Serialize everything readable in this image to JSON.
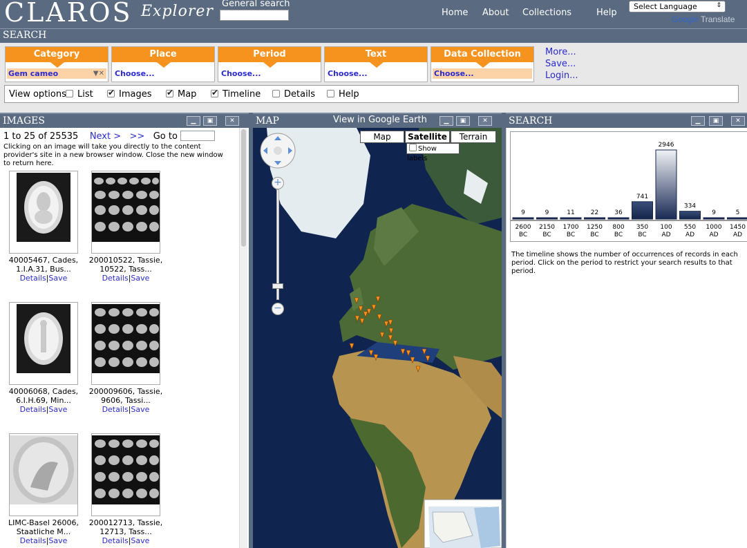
{
  "header": {
    "logo": "CLAROS",
    "logo_sub": "Explorer",
    "general_search_label": "General search",
    "nav": [
      "Home",
      "About",
      "Collections",
      "Help"
    ],
    "language_select": "Select Language",
    "translate_google": "Google",
    "translate_label": "Translate"
  },
  "search_bar": {
    "title": "SEARCH"
  },
  "facets": [
    {
      "label": "Category",
      "value": "Gem cameo"
    },
    {
      "label": "Place",
      "value": "Choose..."
    },
    {
      "label": "Period",
      "value": "Choose..."
    },
    {
      "label": "Text",
      "value": "Choose..."
    },
    {
      "label": "Data Collection",
      "value": "Choose..."
    }
  ],
  "side_links": [
    "More...",
    "Save...",
    "Login..."
  ],
  "view_options": {
    "label": "View options",
    "items": [
      {
        "label": "List",
        "checked": false
      },
      {
        "label": "Images",
        "checked": true
      },
      {
        "label": "Map",
        "checked": true
      },
      {
        "label": "Timeline",
        "checked": true
      },
      {
        "label": "Details",
        "checked": false
      },
      {
        "label": "Help",
        "checked": false
      }
    ]
  },
  "images_panel": {
    "title": "IMAGES",
    "range": "1 to 25 of 25535",
    "next": "Next >",
    "last": ">>",
    "goto": "Go to",
    "info": "Clicking on an image will take you directly to the content provider's site in a new browser window. Close the new window to return here.",
    "thumbs": [
      {
        "caption": "40005467, Cades, 1.I.A.31, Bus...",
        "details": "Details",
        "save": "Save"
      },
      {
        "caption": "200010522, Tassie, 10522, Tass...",
        "details": "Details",
        "save": "Save"
      },
      {
        "caption": "40006068, Cades, 6.I.H.69, Min...",
        "details": "Details",
        "save": "Save"
      },
      {
        "caption": "200009606, Tassie, 9606, Tassi...",
        "details": "Details",
        "save": "Save"
      },
      {
        "caption": "LIMC-Basel 26006, Staatliche M...",
        "details": "Details",
        "save": "Save"
      },
      {
        "caption": "200012713, Tassie, 12713, Tass...",
        "details": "Details",
        "save": "Save"
      }
    ]
  },
  "map_panel": {
    "title": "MAP",
    "google_earth": "View in Google Earth",
    "types": [
      "Map",
      "Satellite",
      "Terrain"
    ],
    "active_type": "Satellite",
    "show_labels": "Show labels"
  },
  "search_panel": {
    "title": "SEARCH",
    "timeline_desc": "The timeline shows the number of occurrences of records in each period. Click on the period to restrict your search results to that period."
  },
  "chart_data": {
    "type": "bar",
    "categories": [
      "2600 BC",
      "2150 BC",
      "1700 BC",
      "1250 BC",
      "800 BC",
      "350 BC",
      "100 AD",
      "550 AD",
      "1000 AD",
      "1450 AD"
    ],
    "values": [
      9,
      9,
      11,
      22,
      36,
      741,
      2946,
      334,
      9,
      5
    ],
    "ylim": [
      0,
      2946
    ]
  },
  "colors": {
    "header": "#5a6a80",
    "facet": "#f6921e",
    "link": "#2a2ad0",
    "bar": "#1a2a55"
  }
}
